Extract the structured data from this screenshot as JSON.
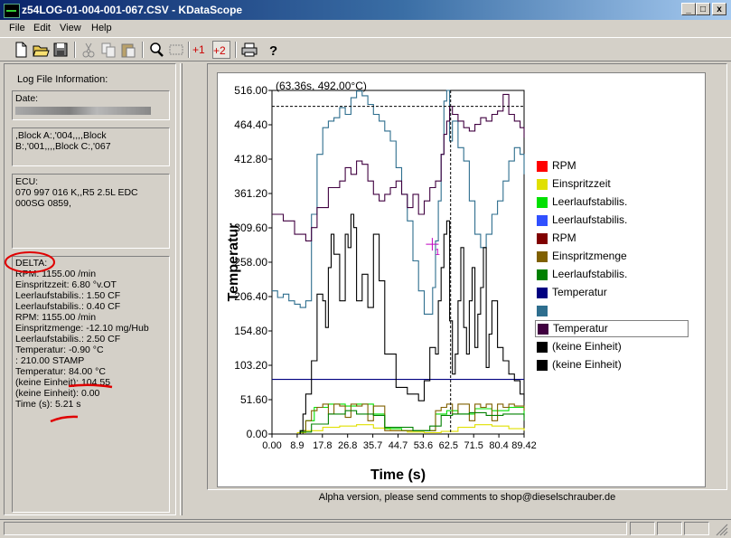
{
  "window": {
    "title": "z54LOG-01-004-001-067.CSV - KDataScope",
    "min_label": "_",
    "max_label": "□",
    "close_label": "x"
  },
  "menu": [
    "File",
    "Edit",
    "View",
    "Help"
  ],
  "toolbar": {
    "icons": [
      "new-file-icon",
      "open-folder-icon",
      "save-disk-icon",
      "cut-icon",
      "copy-icon",
      "paste-icon",
      "zoom-icon",
      "select-rect-icon",
      "cursor-one-icon",
      "cursor-two-icon",
      "print-icon",
      "help-icon"
    ],
    "cursor1_label": "+1",
    "cursor2_label": "+2"
  },
  "log_info": {
    "heading": "Log File Information:",
    "date_label": "Date:",
    "block_lines": [
      ",Block A:,'004,,,,Block",
      "B:,'001,,,,Block C:,'067"
    ],
    "ecu_lines": [
      "ECU:",
      "070 997 016 K,,R5 2.5L EDC",
      "000SG  0859,"
    ],
    "delta_lines": [
      "DELTA:",
      "RPM: 1155.00  /min",
      "Einspritzzeit: 6.80  °v.OT",
      "Leerlaufstabilis.: 1.50  CF",
      "Leerlaufstabilis.: 0.40  CF",
      "RPM: 1155.00  /min",
      "Einspritzmenge: -12.10  mg/Hub",
      "Leerlaufstabilis.: 2.50  CF",
      "Temperatur: -0.90 °C",
      ": 210.00 STAMP",
      "Temperatur: 84.00 °C",
      "(keine Einheit): 104.55",
      "(keine Einheit): 0.00",
      "Time (s): 5.21 s"
    ]
  },
  "chart_data": {
    "type": "line",
    "title": "",
    "xlabel": "Time (s)",
    "ylabel": "Temperatur",
    "xlim": [
      0,
      89.42
    ],
    "ylim": [
      0,
      516
    ],
    "x_ticks": [
      "0.00",
      "8.9",
      "17.8",
      "26.8",
      "35.7",
      "44.7",
      "53.6",
      "62.5",
      "71.5",
      "80.4",
      "89.42"
    ],
    "y_ticks": [
      "516.00",
      "464.40",
      "412.80",
      "361.20",
      "309.60",
      "258.00",
      "206.40",
      "154.80",
      "103.20",
      "51.60",
      "0.00"
    ],
    "cursor_readout": "(63.36s, 492.00°C)",
    "cursor_label": "1",
    "cursor": {
      "x": 63.36,
      "y": 492.0
    },
    "grid": false,
    "legend_position": "right",
    "series": [
      {
        "name": "RPM",
        "color": "#ff0000",
        "x": [
          0,
          10,
          20,
          30,
          40,
          50,
          60,
          70,
          80,
          89.42
        ],
        "y": [
          0,
          0,
          0,
          0,
          0,
          0,
          0,
          0,
          0,
          0
        ]
      },
      {
        "name": "Einspritzzeit",
        "color": "#e0e000",
        "x": [
          0,
          9,
          12,
          18,
          24,
          30,
          36,
          42,
          48,
          54,
          60,
          66,
          72,
          78,
          84,
          89.42
        ],
        "y": [
          0,
          2,
          5,
          10,
          12,
          14,
          9,
          5,
          3,
          2,
          4,
          10,
          14,
          12,
          8,
          5
        ]
      },
      {
        "name": "Leerlaufstabilis.",
        "color": "#00e000",
        "x": [
          0,
          10,
          12,
          15,
          20,
          26,
          30,
          36,
          40,
          46,
          55,
          58,
          62,
          66,
          72,
          78,
          84,
          89.42
        ],
        "y": [
          0,
          5,
          20,
          40,
          45,
          42,
          45,
          30,
          8,
          5,
          5,
          30,
          35,
          30,
          38,
          35,
          40,
          25
        ]
      },
      {
        "name": "Leerlaufstabilis.",
        "color": "#3050ff",
        "x": [
          0,
          30,
          60,
          89.42
        ],
        "y": [
          0,
          0,
          0,
          0
        ]
      },
      {
        "name": "RPM",
        "color": "#800000",
        "x": [
          0,
          30,
          60,
          89.42
        ],
        "y": [
          0,
          0,
          0,
          0
        ]
      },
      {
        "name": "Einspritzmenge",
        "color": "#806000",
        "x": [
          0,
          11,
          12,
          14,
          16,
          18,
          20,
          22,
          24,
          26,
          28,
          30,
          32,
          34,
          36,
          40,
          50,
          56,
          58,
          60,
          62,
          64,
          66,
          68,
          70,
          72,
          74,
          76,
          78,
          80,
          82,
          84,
          86,
          89.42
        ],
        "y": [
          0,
          5,
          20,
          35,
          40,
          45,
          30,
          45,
          42,
          25,
          45,
          42,
          45,
          20,
          42,
          5,
          5,
          5,
          35,
          40,
          45,
          30,
          45,
          45,
          20,
          45,
          40,
          45,
          20,
          45,
          40,
          45,
          42,
          35
        ]
      },
      {
        "name": "Leerlaufstabilis.",
        "color": "#008000",
        "x": [
          0,
          10,
          14,
          20,
          26,
          30,
          36,
          40,
          50,
          56,
          60,
          64,
          70,
          76,
          82,
          89.42
        ],
        "y": [
          0,
          3,
          15,
          30,
          35,
          30,
          28,
          10,
          5,
          12,
          28,
          30,
          32,
          28,
          30,
          20
        ]
      },
      {
        "name": "Temperatur",
        "color": "#000080",
        "x": [
          0,
          89.42
        ],
        "y": [
          82,
          82
        ]
      },
      {
        "name": "",
        "color": "#2e6e8e",
        "x": [
          0,
          2,
          4,
          6,
          8,
          10,
          12,
          14,
          16,
          18,
          20,
          22,
          24,
          26,
          28,
          30,
          32,
          34,
          36,
          38,
          40,
          42,
          44,
          46,
          48,
          50,
          52,
          54,
          56,
          57,
          58,
          59,
          60,
          61,
          62,
          63,
          64,
          66,
          68,
          70,
          72,
          74,
          76,
          78,
          80,
          82,
          84,
          86,
          88,
          89.42
        ],
        "y": [
          215,
          205,
          210,
          200,
          195,
          190,
          200,
          330,
          420,
          460,
          470,
          475,
          490,
          480,
          505,
          515,
          508,
          495,
          480,
          470,
          455,
          440,
          400,
          360,
          320,
          260,
          215,
          180,
          180,
          220,
          290,
          350,
          420,
          500,
          516,
          440,
          470,
          430,
          410,
          350,
          300,
          280,
          300,
          330,
          350,
          380,
          410,
          430,
          420,
          390
        ]
      },
      {
        "name": "Temperatur",
        "color": "#400040",
        "x": [
          0,
          4,
          8,
          12,
          14,
          16,
          20,
          24,
          26,
          28,
          30,
          32,
          34,
          36,
          38,
          40,
          42,
          44,
          46,
          48,
          50,
          52,
          54,
          56,
          58,
          60,
          61,
          62,
          63,
          64,
          66,
          68,
          70,
          72,
          74,
          76,
          78,
          80,
          82,
          84,
          86,
          88,
          89.42
        ],
        "y": [
          330,
          320,
          300,
          290,
          310,
          340,
          370,
          380,
          400,
          390,
          410,
          405,
          380,
          360,
          350,
          360,
          370,
          380,
          360,
          340,
          360,
          330,
          350,
          370,
          380,
          420,
          450,
          470,
          492,
          480,
          470,
          460,
          455,
          465,
          475,
          470,
          480,
          485,
          510,
          480,
          470,
          460,
          445
        ]
      },
      {
        "name": "(keine Einheit)",
        "color": "#000000",
        "x": [
          0,
          8,
          10,
          11,
          12,
          14,
          16,
          18,
          19,
          20,
          21,
          22,
          24,
          26,
          27,
          28,
          29,
          30,
          32,
          34,
          36,
          38,
          40,
          44,
          48,
          52,
          54,
          56,
          58,
          59,
          60,
          61,
          62,
          63,
          64,
          65,
          66,
          67,
          68,
          69,
          70,
          71,
          72,
          73,
          74,
          75,
          76,
          77,
          78,
          80,
          82,
          84,
          86,
          88,
          89.42
        ],
        "y": [
          0,
          0,
          5,
          30,
          60,
          110,
          210,
          200,
          160,
          250,
          300,
          270,
          200,
          300,
          280,
          330,
          310,
          200,
          240,
          190,
          300,
          230,
          120,
          70,
          60,
          50,
          80,
          130,
          120,
          200,
          250,
          300,
          320,
          170,
          90,
          120,
          200,
          280,
          160,
          120,
          200,
          250,
          130,
          180,
          220,
          280,
          100,
          150,
          200,
          130,
          110,
          90,
          80,
          60,
          50
        ]
      },
      {
        "name": "(keine Einheit)",
        "color": "#000000",
        "x": [
          0,
          89.42
        ],
        "y": [
          0,
          0
        ]
      }
    ]
  },
  "footer_text": "Alpha version, please send comments to shop@dieselschrauber.de"
}
